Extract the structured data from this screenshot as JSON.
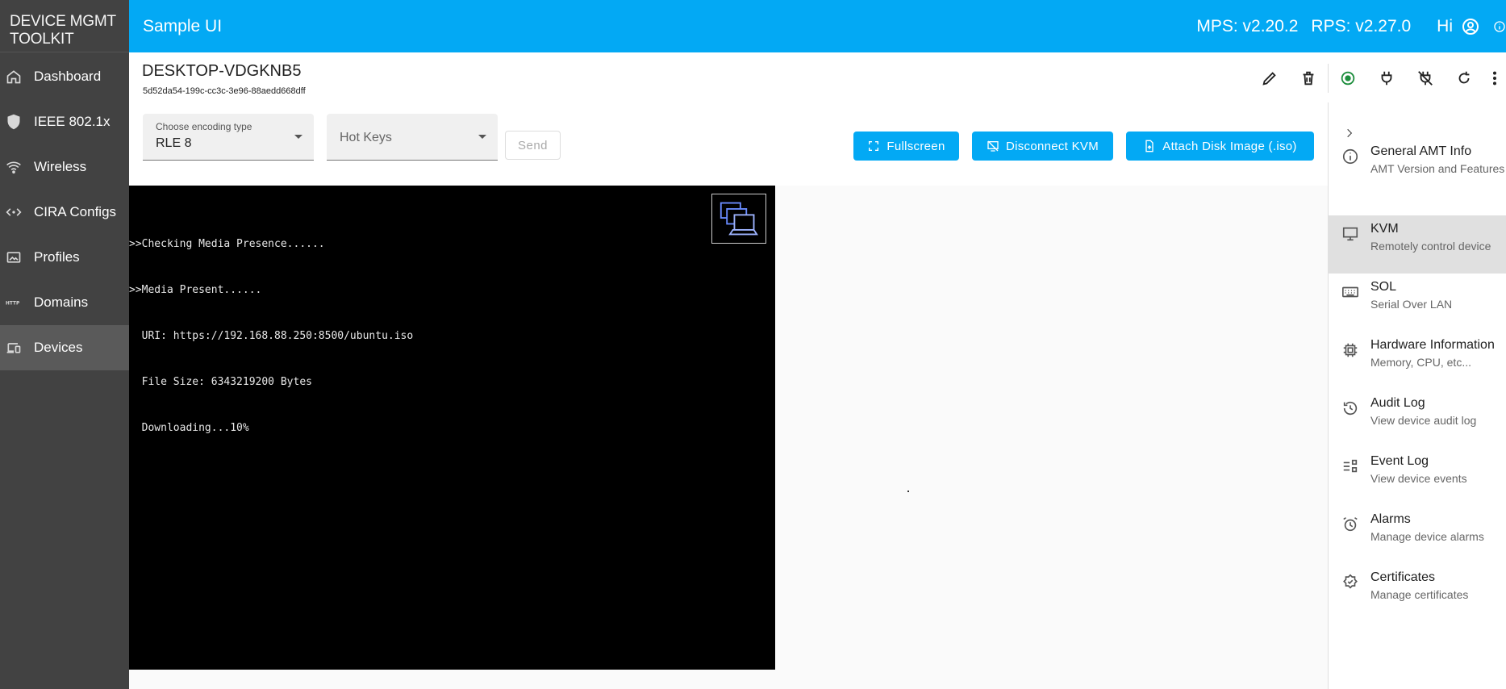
{
  "sidebar": {
    "brand_line1": "DEVICE MGMT",
    "brand_line2": "TOOLKIT",
    "items": [
      {
        "label": "Dashboard",
        "icon": "home-icon"
      },
      {
        "label": "IEEE 802.1x",
        "icon": "shield-icon"
      },
      {
        "label": "Wireless",
        "icon": "wifi-icon"
      },
      {
        "label": "CIRA Configs",
        "icon": "code-icon"
      },
      {
        "label": "Profiles",
        "icon": "profile-icon"
      },
      {
        "label": "Domains",
        "icon": "http-icon"
      },
      {
        "label": "Devices",
        "icon": "devices-icon",
        "active": true
      }
    ]
  },
  "topbar": {
    "title": "Sample UI",
    "mps": "MPS: v2.20.2",
    "rps": "RPS: v2.27.0",
    "greeting": "Hi"
  },
  "device": {
    "name": "DESKTOP-VDGKNB5",
    "guid": "5d52da54-199c-cc3c-3e96-88aedd668dff"
  },
  "controls": {
    "encoding_label": "Choose encoding type",
    "encoding_value": "RLE 8",
    "hotkeys_placeholder": "Hot Keys",
    "send_label": "Send",
    "fullscreen_label": "Fullscreen",
    "disconnect_label": "Disconnect KVM",
    "attach_label": "Attach Disk Image (.iso)"
  },
  "console": {
    "lines": [
      ">>Checking Media Presence......",
      ">>Media Present......",
      "  URI: https://192.168.88.250:8500/ubuntu.iso",
      "  File Size: 6343219200 Bytes",
      "  Downloading...10%"
    ]
  },
  "right_panel": {
    "items": [
      {
        "title": "General AMT Info",
        "subtitle": "AMT Version and Features",
        "icon": "info-icon"
      },
      {
        "title": "KVM",
        "subtitle": "Remotely control device",
        "icon": "monitor-icon",
        "active": true
      },
      {
        "title": "SOL",
        "subtitle": "Serial Over LAN",
        "icon": "keyboard-icon"
      },
      {
        "title": "Hardware Information",
        "subtitle": "Memory, CPU, etc...",
        "icon": "chip-icon"
      },
      {
        "title": "Audit Log",
        "subtitle": "View device audit log",
        "icon": "history-icon"
      },
      {
        "title": "Event Log",
        "subtitle": "View device events",
        "icon": "event-list-icon"
      },
      {
        "title": "Alarms",
        "subtitle": "Manage device alarms",
        "icon": "alarm-icon"
      },
      {
        "title": "Certificates",
        "subtitle": "Manage certificates",
        "icon": "certificate-icon"
      }
    ]
  },
  "colors": {
    "primary": "#03a9f4",
    "sidebar_bg": "#424242",
    "power_on": "#1e8e3e"
  }
}
